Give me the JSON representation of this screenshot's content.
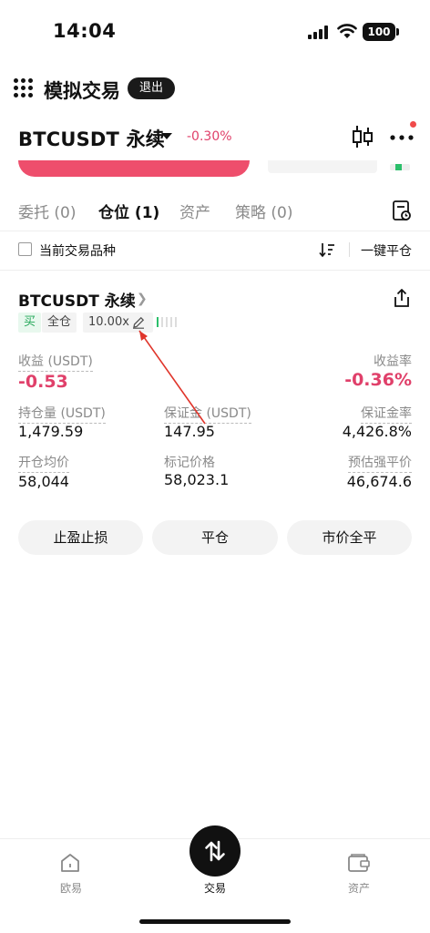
{
  "status_bar": {
    "time": "14:04",
    "battery": "100"
  },
  "header": {
    "title": "模拟交易",
    "exit_label": "退出",
    "symbol": "BTCUSDT 永续",
    "change": "-0.30%"
  },
  "tabs": [
    {
      "label": "委托 (0)"
    },
    {
      "label": "仓位 (1)"
    },
    {
      "label": "资产"
    },
    {
      "label": "策略 (0)"
    }
  ],
  "filter": {
    "current_symbol_label": "当前交易品种",
    "close_all_label": "一键平仓"
  },
  "position": {
    "symbol": "BTCUSDT 永续",
    "side_tag": "买",
    "margin_mode_tag": "全仓",
    "leverage": "10.00x",
    "pnl_label": "收益 (USDT)",
    "pnl_value": "-0.53",
    "roe_label": "收益率",
    "roe_value": "-0.36%",
    "size_label": "持仓量 (USDT)",
    "size_value": "1,479.59",
    "margin_label": "保证金 (USDT)",
    "margin_value": "147.95",
    "margin_ratio_label": "保证金率",
    "margin_ratio_value": "4,426.8%",
    "entry_label": "开仓均价",
    "entry_value": "58,044",
    "mark_label": "标记价格",
    "mark_value": "58,023.1",
    "liq_label": "预估强平价",
    "liq_value": "46,674.6"
  },
  "actions": {
    "tp_sl": "止盈止损",
    "close": "平仓",
    "market_close": "市价全平"
  },
  "bottom_nav": [
    {
      "label": "欧易",
      "icon": "home-icon"
    },
    {
      "label": "交易",
      "icon": "trade-swap-icon"
    },
    {
      "label": "资产",
      "icon": "wallet-icon"
    }
  ],
  "colors": {
    "negative": "#e0406a",
    "buy_green": "#25a85a",
    "dark": "#111111",
    "annotation": "#e0352b"
  }
}
